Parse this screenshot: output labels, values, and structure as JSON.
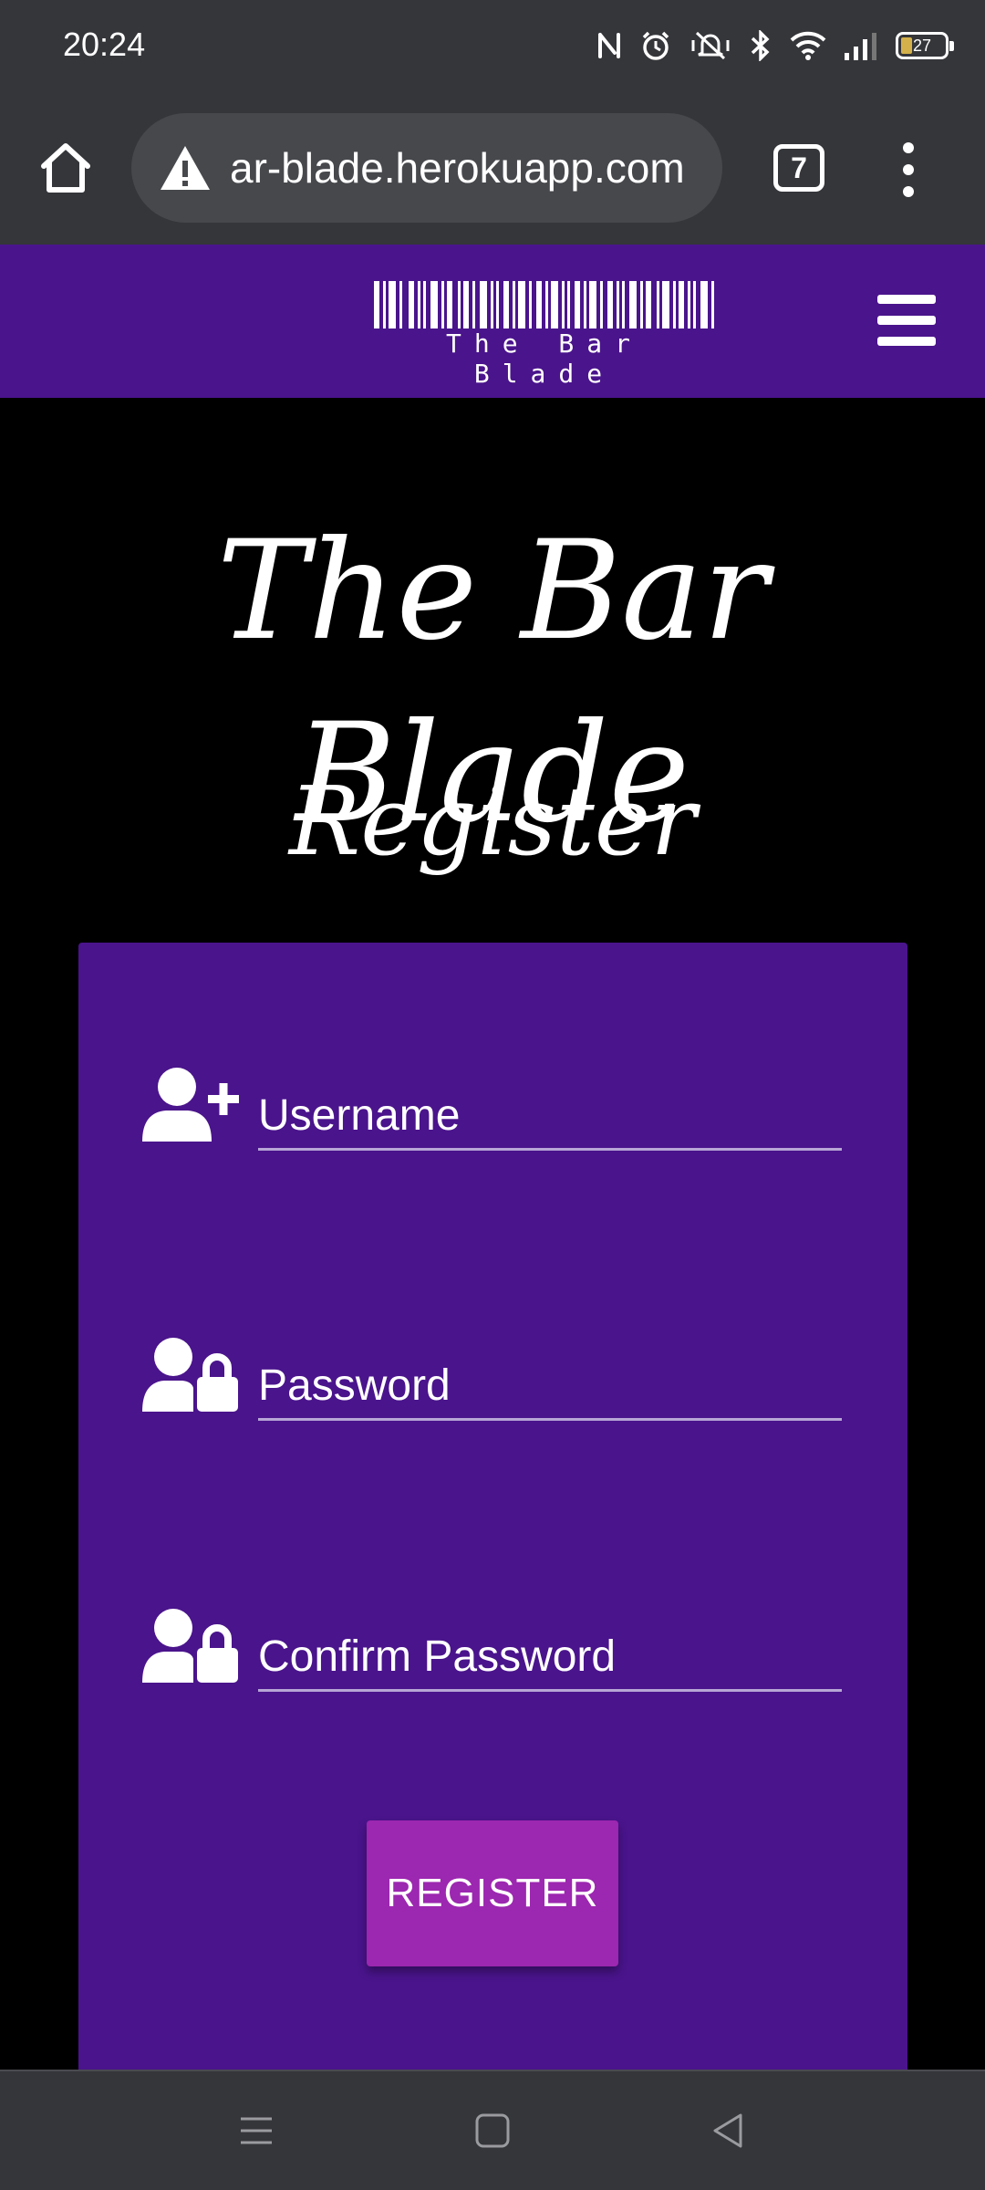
{
  "status_bar": {
    "time": "20:24",
    "battery_level": "27",
    "icons": [
      "nfc-icon",
      "alarm-icon",
      "vibrate-off-icon",
      "bluetooth-icon",
      "wifi-icon",
      "signal-icon",
      "battery-icon"
    ]
  },
  "browser": {
    "url": "ar-blade.herokuapp.com",
    "tab_count": "7",
    "security_icon": "warning-icon"
  },
  "site_nav": {
    "logo_text": "The Bar Blade",
    "menu_icon": "hamburger-icon"
  },
  "main": {
    "brand_heading": "The Bar Blade",
    "page_heading": "Register"
  },
  "form": {
    "username_placeholder": "Username",
    "password_placeholder": "Password",
    "confirm_password_placeholder": "Confirm Password",
    "register_label": "REGISTER"
  },
  "colors": {
    "accent_purple": "#4a148c",
    "button_purple": "#9c27b0",
    "chrome_gray": "#35363a"
  }
}
